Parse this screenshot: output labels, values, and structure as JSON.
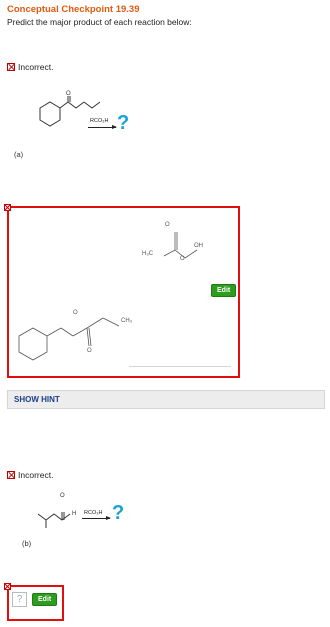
{
  "header": {
    "title": "Conceptual Checkpoint 19.39",
    "instruction": "Predict the major product of each reaction below:"
  },
  "parts": [
    {
      "status": "Incorrect.",
      "label": "(a)",
      "reagent": "RCO₃H",
      "question_mark": "?",
      "answer": {
        "atom_labels": {
          "o_top": "O",
          "oh": "OH",
          "h3c": "H₃C",
          "o_mid": "O",
          "ch3": "CH₃",
          "o_bottom": "O",
          "o_ring": "O"
        },
        "edit_label": "Edit"
      }
    },
    {
      "status": "Incorrect.",
      "label": "(b)",
      "reagent": "RCO₃H",
      "question_mark": "?",
      "atom_labels": {
        "o_top": "O",
        "h": "H"
      },
      "answer": {
        "empty_marker": "?",
        "edit_label": "Edit"
      }
    }
  ],
  "hint": {
    "label": "SHOW HINT"
  },
  "colors": {
    "title": "#e05a10",
    "hint_text": "#1b3f8a",
    "edit": "#2d9d1f",
    "error_border": "#e01010",
    "qmark": "#1aa2d8"
  }
}
